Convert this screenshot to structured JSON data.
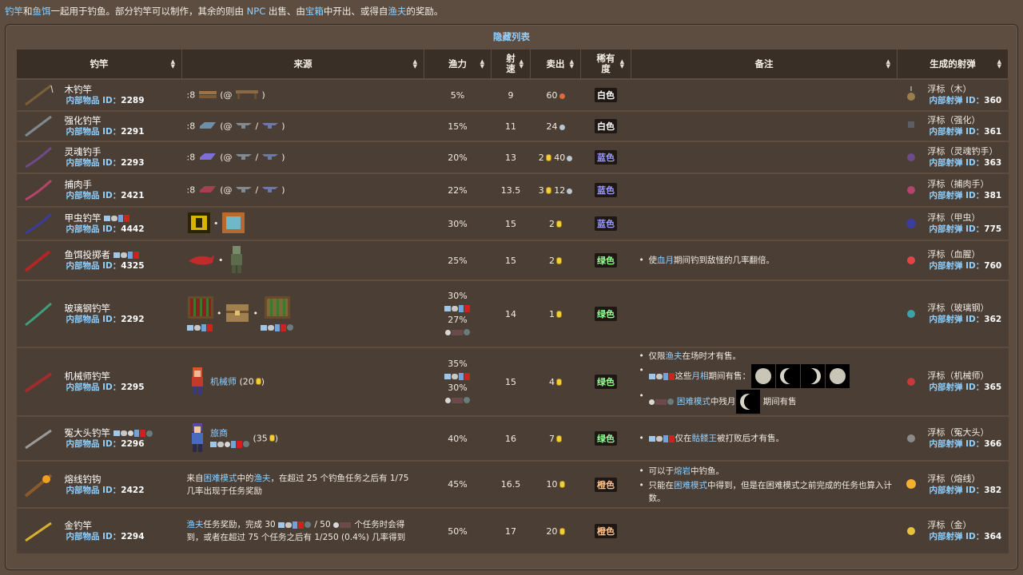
{
  "intro": {
    "parts": [
      "钓竿",
      "和",
      "鱼饵",
      "一起用于钓鱼。部分钓竿可以制作，其余的则由 ",
      "NPC",
      " 出售、由",
      "宝箱",
      "中开出、或得自",
      "渔夫",
      "的奖励。"
    ]
  },
  "table_title": "隐藏列表",
  "headers": [
    "钓竿",
    "来源",
    "渔力",
    "射速",
    "卖出",
    "稀有度",
    "备注",
    "生成的射弹"
  ],
  "id_label": "内部物品 ID：",
  "proj_id_label_a": "内部",
  "proj_id_label_b": "射弹",
  "proj_id_label_c": " ID：",
  "rows": [
    {
      "name": "木钓竿",
      "id": "2289",
      "source_prefix": ":8",
      "source_suffix": "(@",
      "power": "5%",
      "speed": "9",
      "sell_a": "60",
      "sell_b": "",
      "rarity": "白色",
      "proj": "浮标（木）",
      "proj_id": "360"
    },
    {
      "name": "强化钓竿",
      "id": "2291",
      "source_prefix": ":8",
      "source_suffix": "(@",
      "power": "15%",
      "speed": "11",
      "sell_a": "24",
      "sell_b": "",
      "rarity": "白色",
      "proj": "浮标（强化）",
      "proj_id": "361"
    },
    {
      "name": "灵魂钓手",
      "id": "2293",
      "source_prefix": ":8",
      "source_suffix": "(@",
      "power": "20%",
      "speed": "13",
      "sell_a": "2",
      "sell_b": "40",
      "rarity": "蓝色",
      "proj": "浮标（灵魂钓手）",
      "proj_id": "363"
    },
    {
      "name": "捕肉手",
      "id": "2421",
      "source_prefix": ":8",
      "source_suffix": "(@",
      "power": "22%",
      "speed": "13.5",
      "sell_a": "3",
      "sell_b": "12",
      "rarity": "蓝色",
      "proj": "浮标（捕肉手）",
      "proj_id": "381"
    },
    {
      "name": "甲虫钓竿",
      "id": "4442",
      "power": "30%",
      "speed": "15",
      "sell_a": "2",
      "rarity": "蓝色",
      "proj": "浮标（甲虫）",
      "proj_id": "775"
    },
    {
      "name": "鱼饵投掷者",
      "id": "4325",
      "power": "25%",
      "speed": "15",
      "sell_a": "2",
      "rarity": "绿色",
      "note": [
        "使",
        "血月",
        "期间钓到敌怪的几率翻倍。"
      ],
      "proj": "浮标（血腥）",
      "proj_id": "760"
    },
    {
      "name": "玻璃钢钓竿",
      "id": "2292",
      "power_a": "30%",
      "power_b": "27%",
      "speed": "14",
      "sell_a": "1",
      "rarity": "绿色",
      "proj": "浮标（玻璃钢）",
      "proj_id": "362"
    },
    {
      "name": "机械师钓竿",
      "id": "2295",
      "source_npc": "机械师",
      "source_price": "(20",
      "power_a": "35%",
      "power_b": "30%",
      "speed": "15",
      "sell_a": "4",
      "rarity": "绿色",
      "note_1": [
        "仅限",
        "渔夫",
        "在场时才有售。"
      ],
      "note_2": [
        "这些",
        "月相",
        "期间有售："
      ],
      "note_3": [
        "困难模式",
        "中残月",
        "期间有售"
      ],
      "proj": "浮标（机械师）",
      "proj_id": "365"
    },
    {
      "name": "冤大头钓竿",
      "id": "2296",
      "source_npc": "旅商",
      "source_price": "(35",
      "power": "40%",
      "speed": "16",
      "sell_a": "7",
      "rarity": "绿色",
      "note": [
        "仅在",
        "骷髅王",
        "被打败后才有售。"
      ],
      "proj": "浮标（冤大头）",
      "proj_id": "366"
    },
    {
      "name": "熔线钓钩",
      "id": "2422",
      "source_text": [
        "来自",
        "困难模式",
        "中的",
        "渔夫",
        "，在超过 25 个钓鱼任务之后有 1/75 几率出现于任务奖励"
      ],
      "power": "45%",
      "speed": "16.5",
      "sell_a": "10",
      "rarity": "橙色",
      "note_1": [
        "可以于",
        "熔岩",
        "中钓鱼。"
      ],
      "note_2": [
        "只能在",
        "困难模式",
        "中得到，但是在困难模式之前完成的任务也算入计数。"
      ],
      "proj": "浮标（熔线）",
      "proj_id": "382"
    },
    {
      "name": "金钓竿",
      "id": "2294",
      "source_text": [
        "渔夫",
        "任务奖励，完成 30 ",
        "/ 50 ",
        "个任务时会得到，或者在超过 75 个任务之后有 1/250 (0.4%) 几率得到"
      ],
      "power": "50%",
      "speed": "17",
      "sell_a": "20",
      "rarity": "橙色",
      "proj": "浮标（金）",
      "proj_id": "364"
    }
  ],
  "colors": {
    "link": "#8fd0ff",
    "bg": "#5d4d40",
    "row": "#4b3e34",
    "header": "#3a2f27"
  }
}
